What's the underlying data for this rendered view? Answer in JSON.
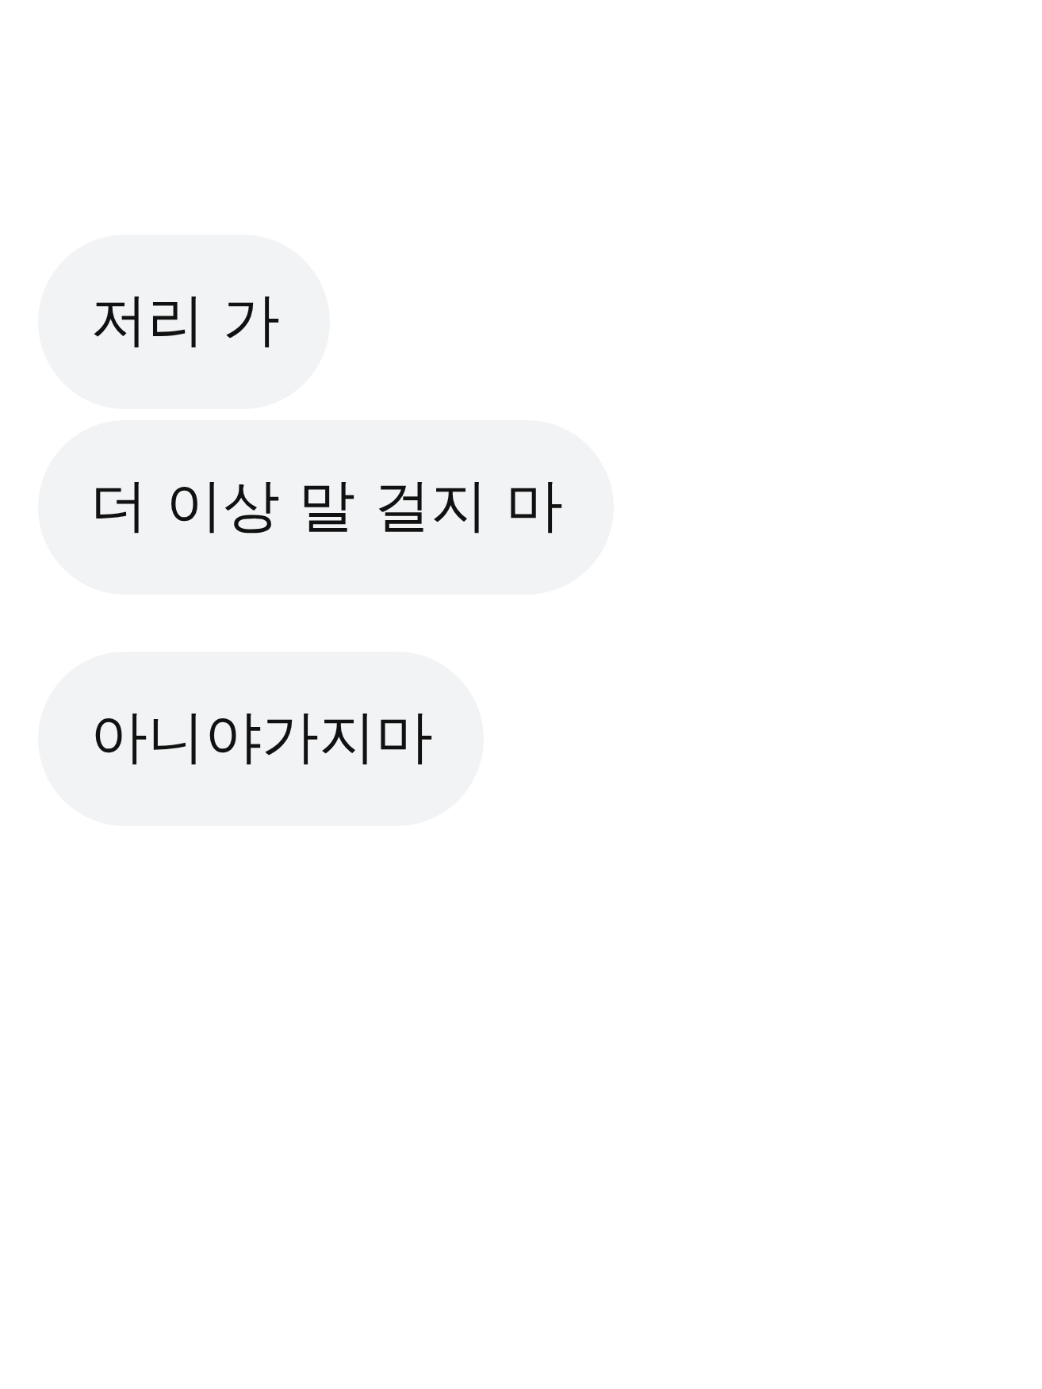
{
  "message_groups": [
    {
      "messages": [
        {
          "text": "저리 가"
        },
        {
          "text": "더 이상 말 걸지 마"
        }
      ]
    },
    {
      "messages": [
        {
          "text": "아니야가지마"
        }
      ]
    }
  ]
}
